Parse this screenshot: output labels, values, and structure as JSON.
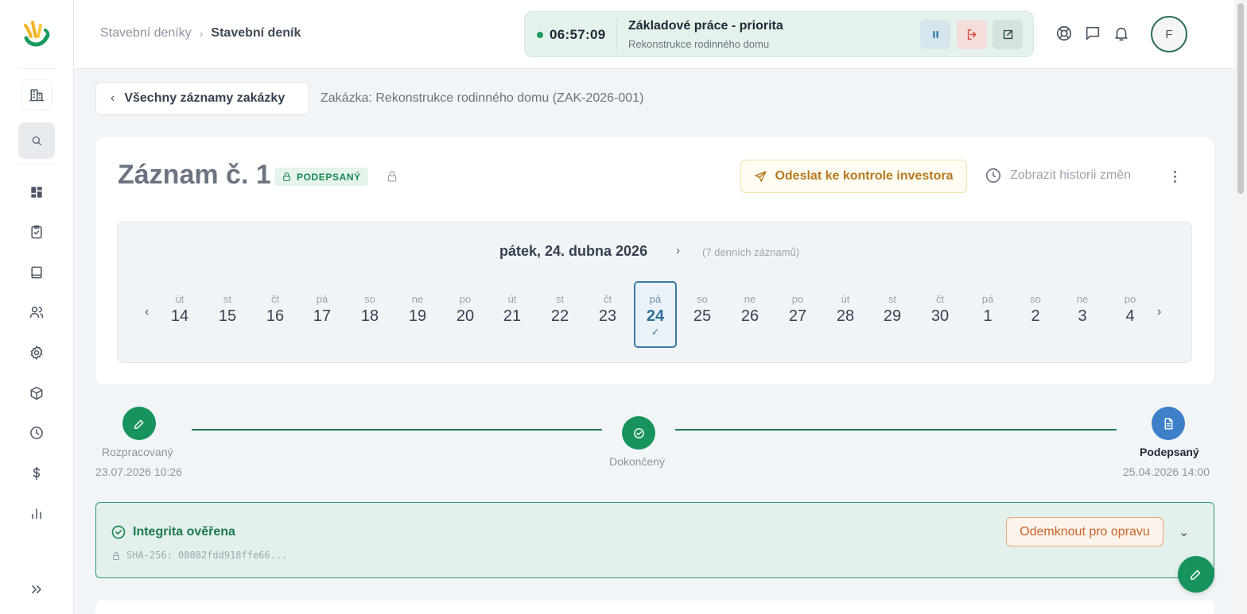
{
  "breadcrumb": {
    "parent": "Stavební deníky",
    "current": "Stavební deník"
  },
  "timer": {
    "time": "06:57:09",
    "title": "Základové práce - priorita",
    "subtitle": "Rekonstrukce rodinného domu"
  },
  "user": {
    "initial": "F"
  },
  "back_button": {
    "label": "Všechny záznamy zakázky"
  },
  "contract_info": "Zakázka: Rekonstrukce rodinného domu (ZAK-2026-001)",
  "record": {
    "title": "Záznam č. 1",
    "badge": "PODEPSANÝ",
    "send_button": "Odeslat ke kontrole investora",
    "history_button": "Zobrazit historii změn"
  },
  "calendar": {
    "date_label": "pátek, 24. dubna 2026",
    "count_label": "(7 denních záznamů)",
    "days": [
      {
        "dow": "út",
        "num": "14"
      },
      {
        "dow": "st",
        "num": "15"
      },
      {
        "dow": "čt",
        "num": "16"
      },
      {
        "dow": "pá",
        "num": "17"
      },
      {
        "dow": "so",
        "num": "18"
      },
      {
        "dow": "ne",
        "num": "19"
      },
      {
        "dow": "po",
        "num": "20"
      },
      {
        "dow": "út",
        "num": "21"
      },
      {
        "dow": "st",
        "num": "22"
      },
      {
        "dow": "čt",
        "num": "23"
      },
      {
        "dow": "pá",
        "num": "24",
        "selected": true,
        "check": "✓"
      },
      {
        "dow": "so",
        "num": "25"
      },
      {
        "dow": "ne",
        "num": "26"
      },
      {
        "dow": "po",
        "num": "27"
      },
      {
        "dow": "út",
        "num": "28"
      },
      {
        "dow": "st",
        "num": "29"
      },
      {
        "dow": "čt",
        "num": "30"
      },
      {
        "dow": "pá",
        "num": "1"
      },
      {
        "dow": "so",
        "num": "2"
      },
      {
        "dow": "ne",
        "num": "3"
      },
      {
        "dow": "po",
        "num": "4"
      }
    ]
  },
  "status_steps": [
    {
      "label": "Rozpracovaný",
      "date": "23.07.2026 10:26"
    },
    {
      "label": "Dokončený",
      "date": ""
    },
    {
      "label": "Podepsaný",
      "date": "25.04.2026 14:00"
    }
  ],
  "integrity": {
    "title": "Integrita ověřena",
    "hash": "SHA-256: 08082fdd918ffe66...",
    "unlock_button": "Odemknout pro opravu"
  },
  "colors": {
    "primary_green": "#17935d",
    "signed_blue": "#3d7fc8",
    "warning_amber": "#b7791f",
    "unlock_orange": "#c86528"
  }
}
